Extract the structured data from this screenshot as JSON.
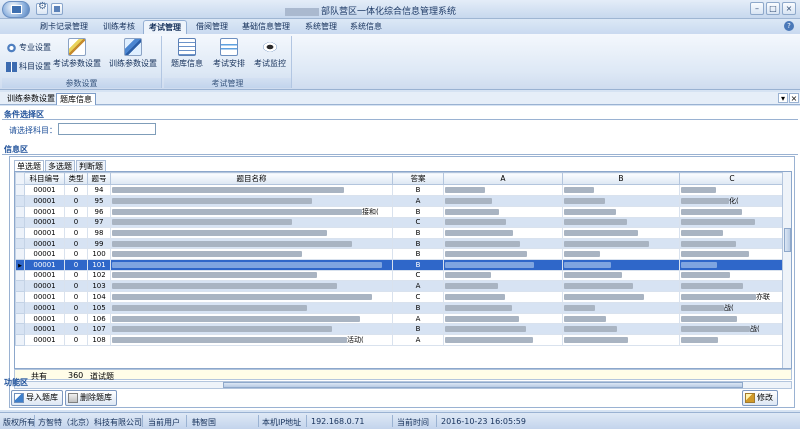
{
  "window": {
    "title": "部队营区一体化综合信息管理系统",
    "controls": [
      "–",
      "□",
      "×"
    ]
  },
  "ribbon_tabs": [
    {
      "label": "刷卡记录管理",
      "active": false
    },
    {
      "label": "训练考核",
      "active": false
    },
    {
      "label": "考试管理",
      "active": true
    },
    {
      "label": "借阅管理",
      "active": false
    },
    {
      "label": "基础信息管理",
      "active": false
    },
    {
      "label": "系统管理",
      "active": false
    },
    {
      "label": "系统信息",
      "active": false
    }
  ],
  "ribbon": {
    "group1": {
      "label": "参数设置",
      "small_buttons": [
        {
          "label": "专业设置",
          "icon": "gear-icon"
        },
        {
          "label": "科目设置",
          "icon": "book-icon"
        }
      ],
      "buttons": [
        {
          "label": "考试参数设置",
          "icon": "pencil-icon"
        },
        {
          "label": "训练参数设置",
          "icon": "pencil-icon"
        }
      ]
    },
    "group2": {
      "label": "考试管理",
      "buttons": [
        {
          "label": "题库信息",
          "icon": "grid-icon"
        },
        {
          "label": "考试安排",
          "icon": "note-icon"
        },
        {
          "label": "考试监控",
          "icon": "eye-icon"
        }
      ]
    }
  },
  "doc_tabs": [
    {
      "label": "训练参数设置",
      "active": false
    },
    {
      "label": "题库信息",
      "active": true
    }
  ],
  "condition": {
    "title": "条件选择区",
    "subject_label": "请选择科目：",
    "subject_value": ""
  },
  "info": {
    "title": "信息区",
    "inner_tabs": [
      "单选题",
      "多选题",
      "判断题"
    ],
    "columns": [
      "科目编号",
      "类型",
      "题号",
      "题目名称",
      "答案",
      "A",
      "B",
      "C"
    ],
    "rows": [
      {
        "subject": "00001",
        "type": "0",
        "no": "94",
        "name_tail": "",
        "answer": "B",
        "c_tail": ""
      },
      {
        "subject": "00001",
        "type": "0",
        "no": "95",
        "name_tail": "",
        "answer": "A",
        "c_tail": "化("
      },
      {
        "subject": "00001",
        "type": "0",
        "no": "96",
        "name_tail": "接和(",
        "answer": "B",
        "c_tail": ""
      },
      {
        "subject": "00001",
        "type": "0",
        "no": "97",
        "name_tail": "",
        "answer": "C",
        "c_tail": ""
      },
      {
        "subject": "00001",
        "type": "0",
        "no": "98",
        "name_tail": "",
        "answer": "B",
        "c_tail": ""
      },
      {
        "subject": "00001",
        "type": "0",
        "no": "99",
        "name_tail": "",
        "answer": "B",
        "c_tail": ""
      },
      {
        "subject": "00001",
        "type": "0",
        "no": "100",
        "name_tail": "",
        "answer": "B",
        "c_tail": ""
      },
      {
        "subject": "00001",
        "type": "0",
        "no": "101",
        "name_tail": "",
        "answer": "B",
        "c_tail": ""
      },
      {
        "subject": "00001",
        "type": "0",
        "no": "102",
        "name_tail": "",
        "answer": "C",
        "c_tail": ""
      },
      {
        "subject": "00001",
        "type": "0",
        "no": "103",
        "name_tail": "",
        "answer": "A",
        "c_tail": ""
      },
      {
        "subject": "00001",
        "type": "0",
        "no": "104",
        "name_tail": "",
        "answer": "C",
        "c_tail": "亦联"
      },
      {
        "subject": "00001",
        "type": "0",
        "no": "105",
        "name_tail": "",
        "answer": "B",
        "c_tail": "战("
      },
      {
        "subject": "00001",
        "type": "0",
        "no": "106",
        "name_tail": "",
        "answer": "A",
        "c_tail": ""
      },
      {
        "subject": "00001",
        "type": "0",
        "no": "107",
        "name_tail": "",
        "answer": "B",
        "c_tail": "战("
      },
      {
        "subject": "00001",
        "type": "0",
        "no": "108",
        "name_tail": "活动(",
        "answer": "A",
        "c_tail": ""
      }
    ],
    "selected_row": 7,
    "totals": {
      "label": "共有",
      "count": "360",
      "unit": "道试题"
    }
  },
  "function_area": {
    "title": "功能区",
    "import_label": "导入题库",
    "delete_label": "删除题库",
    "edit_label": "修改"
  },
  "statusbar": {
    "copyright_label": "版权所有",
    "company": "方智特（北京）科技有限公司",
    "current_user_label": "当前用户",
    "current_user": "韩智国",
    "ip_label": "本机IP地址",
    "ip": "192.168.0.71",
    "time_label": "当前时间",
    "time": "2016-10-23 16:05:59"
  },
  "colors": {
    "accent": "#2f67c9",
    "section_title": "#1d4f99",
    "ribbon_bg": "#dde8f5"
  }
}
